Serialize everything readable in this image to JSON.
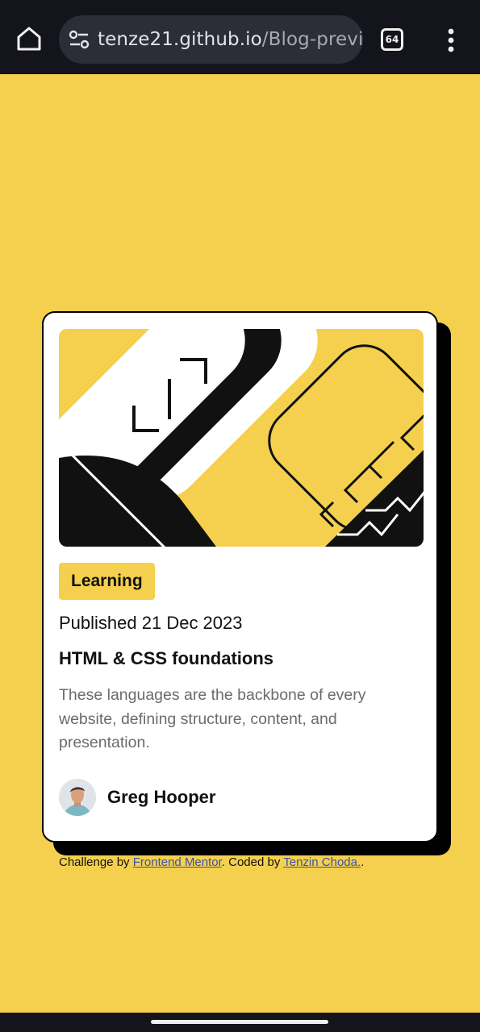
{
  "browser": {
    "url_host": "tenze21.github.io",
    "url_path": "/Blog-previe",
    "tab_count": "64"
  },
  "card": {
    "tag": "Learning",
    "published": "Published 21 Dec 2023",
    "title": "HTML & CSS foundations",
    "description": "These languages are the backbone of every website, defining structure, content, and presentation.",
    "author": "Greg Hooper"
  },
  "attribution": {
    "prefix": "Challenge by ",
    "link1": "Frontend Mentor",
    "middle": ". Coded by ",
    "link2": "Tenzin Choda.",
    "suffix": "."
  },
  "colors": {
    "background": "#f4d04e",
    "chrome": "#14141c",
    "link": "#3e52a3"
  }
}
